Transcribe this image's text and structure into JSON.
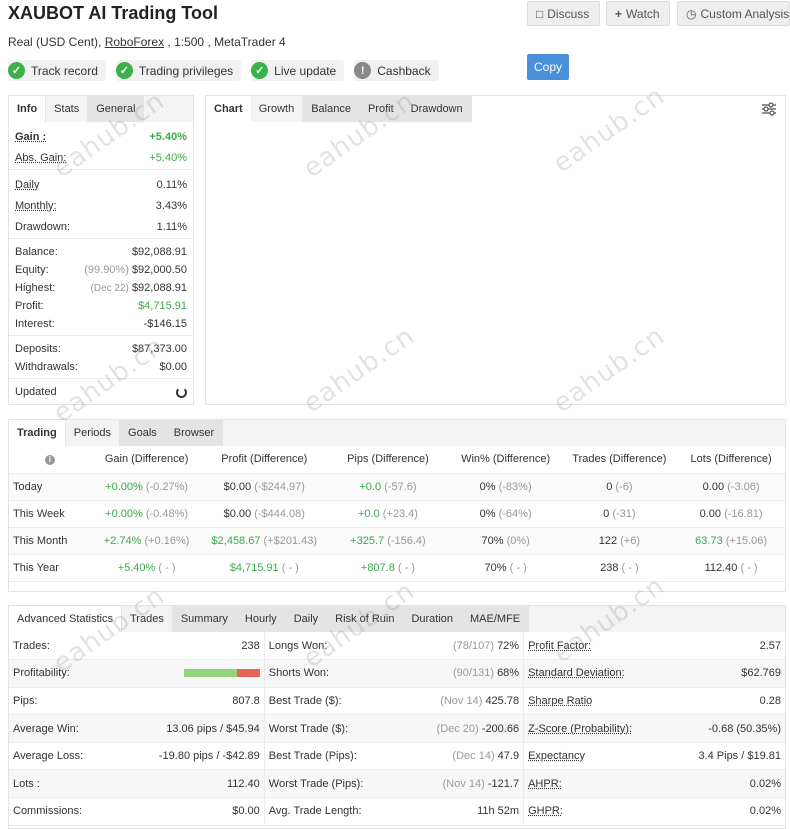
{
  "header": {
    "title": "XAUBOT AI Trading Tool",
    "subtitle_prefix": "Real (USD Cent), ",
    "broker": "RoboForex",
    "subtitle_suffix": " , 1:500 , MetaTrader 4",
    "discuss": "Discuss",
    "watch": "Watch",
    "custom": "Custom Analysis",
    "copy": "Copy"
  },
  "badges": [
    "Track record",
    "Trading privileges",
    "Live update",
    "Cashback"
  ],
  "info": {
    "tabs": [
      "Info",
      "Stats",
      "General"
    ],
    "gain_label": "Gain :",
    "gain": "+5.40%",
    "abs_gain_label": "Abs. Gain:",
    "abs_gain": "+5.40%",
    "daily_label": "Daily",
    "daily": "0.11%",
    "monthly_label": "Monthly:",
    "monthly": "3.43%",
    "drawdown_label": "Drawdown:",
    "drawdown": "1.11%",
    "balance_label": "Balance:",
    "balance": "$92,088.91",
    "equity_label": "Equity:",
    "equity_pct": "(99.90%)",
    "equity": "$92,000.50",
    "highest_label": "Highest:",
    "highest_date": "(Dec 22)",
    "highest": "$92,088.91",
    "profit_label": "Profit:",
    "profit": "$4,715.91",
    "interest_label": "Interest:",
    "interest": "-$146.15",
    "deposits_label": "Deposits:",
    "deposits": "$87,373.00",
    "withdrawals_label": "Withdrawals:",
    "withdrawals": "$0.00",
    "updated_label": "Updated"
  },
  "chart": {
    "tabs": [
      "Chart",
      "Growth",
      "Balance",
      "Profit",
      "Drawdown"
    ]
  },
  "periods": {
    "tabs": [
      "Trading",
      "Periods",
      "Goals",
      "Browser"
    ],
    "headers": [
      "Gain (Difference)",
      "Profit (Difference)",
      "Pips (Difference)",
      "Win% (Difference)",
      "Trades (Difference)",
      "Lots (Difference)"
    ],
    "rows": [
      {
        "label": "Today",
        "gain": "+0.00%",
        "gain_d": "(-0.27%)",
        "profit": "$0.00",
        "profit_d": "(-$244.97)",
        "pips": "+0.0",
        "pips_d": "(-57.6)",
        "win": "0%",
        "win_d": "(-83%)",
        "trades": "0",
        "trades_d": "(-6)",
        "lots": "0.00",
        "lots_d": "(-3.06)"
      },
      {
        "label": "This Week",
        "gain": "+0.00%",
        "gain_d": "(-0.48%)",
        "profit": "$0.00",
        "profit_d": "(-$444.08)",
        "pips": "+0.0",
        "pips_d": "(+23.4)",
        "win": "0%",
        "win_d": "(-64%)",
        "trades": "0",
        "trades_d": "(-31)",
        "lots": "0.00",
        "lots_d": "(-16.81)"
      },
      {
        "label": "This Month",
        "gain": "+2.74%",
        "gain_d": "(+0.16%)",
        "profit": "$2,458.67",
        "profit_d": "(+$201.43)",
        "pips": "+325.7",
        "pips_d": "(-156.4)",
        "win": "70%",
        "win_d": "(0%)",
        "trades": "122",
        "trades_d": "(+6)",
        "lots": "63.73",
        "lots_d": "(+15.06)"
      },
      {
        "label": "This Year",
        "gain": "+5.40%",
        "gain_d": "( - )",
        "profit": "$4,715.91",
        "profit_d": "( - )",
        "pips": "+807.8",
        "pips_d": "( - )",
        "win": "70%",
        "win_d": "( - )",
        "trades": "238",
        "trades_d": "( - )",
        "lots": "112.40",
        "lots_d": "( - )"
      }
    ]
  },
  "advanced": {
    "tabs": [
      "Advanced Statistics",
      "Trades",
      "Summary",
      "Hourly",
      "Daily",
      "Risk of Ruin",
      "Duration",
      "MAE/MFE"
    ],
    "rows": [
      {
        "l1": "Trades:",
        "v1": "238",
        "l2": "Longs Won:",
        "m2": "(78/107)",
        "v2": "72%",
        "l3": "Profit Factor:",
        "v3": "2.57"
      },
      {
        "l1": "Profitability:",
        "v1": "",
        "l2": "Shorts Won:",
        "m2": "(90/131)",
        "v2": "68%",
        "l3": "Standard Deviation:",
        "v3": "$62.769"
      },
      {
        "l1": "Pips:",
        "v1": "807.8",
        "l2": "Best Trade ($):",
        "m2": "(Nov 14)",
        "v2": "425.78",
        "l3": "Sharpe Ratio",
        "v3": "0.28"
      },
      {
        "l1": "Average Win:",
        "v1": "13.06 pips / $45.94",
        "l2": "Worst Trade ($):",
        "m2": "(Dec 20)",
        "v2": "-200.66",
        "l3": "Z-Score (Probability):",
        "v3": "-0.68 (50.35%)"
      },
      {
        "l1": "Average Loss:",
        "v1": "-19.80 pips / -$42.89",
        "l2": "Best Trade (Pips):",
        "m2": "(Dec 14)",
        "v2": "47.9",
        "l3": "Expectancy",
        "v3": "3.4 Pips / $19.81"
      },
      {
        "l1": "Lots :",
        "v1": "112.40",
        "l2": "Worst Trade (Pips):",
        "m2": "(Nov 14)",
        "v2": "-121.7",
        "l3": "AHPR:",
        "v3": "0.02%"
      },
      {
        "l1": "Commissions:",
        "v1": "$0.00",
        "l2": "Avg. Trade Length:",
        "m2": "",
        "v2": "11h 52m",
        "l3": "GHPR:",
        "v3": "0.02%"
      }
    ],
    "profitability_pct": 70
  },
  "watermark": "eahub.cn"
}
